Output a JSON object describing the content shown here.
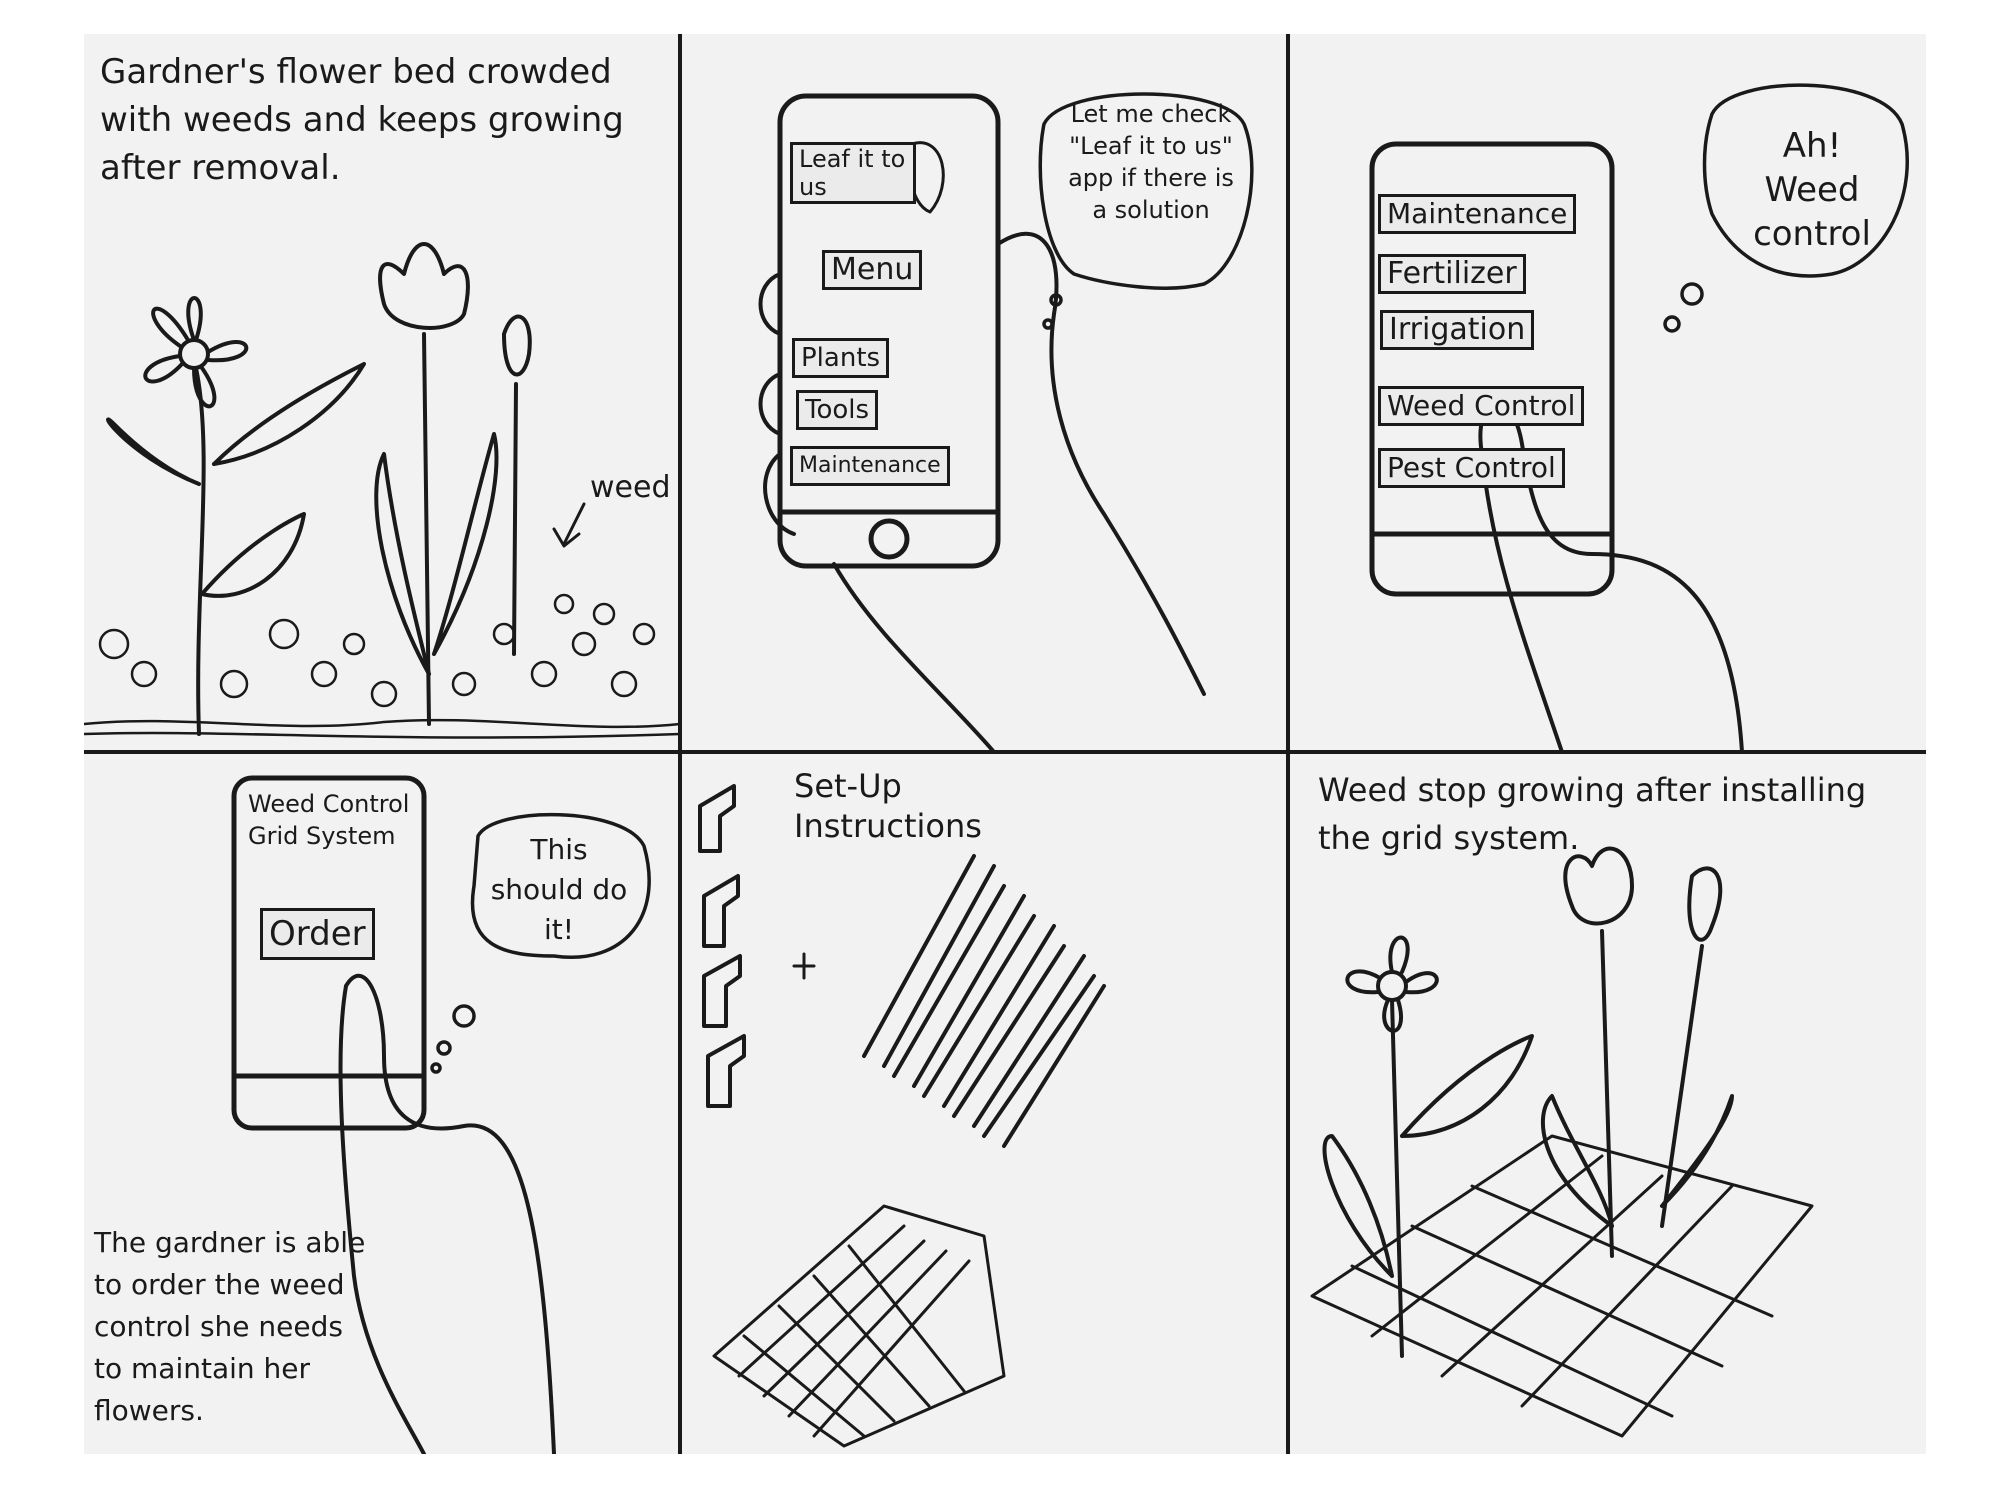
{
  "panels": {
    "p1": {
      "caption": "Gardner's flower bed crowded with weeds and keeps growing after removal.",
      "label": "weed"
    },
    "p2": {
      "app_title": "Leaf it to us",
      "menu": "Menu",
      "items": [
        "Plants",
        "Tools",
        "Maintenance"
      ],
      "bubble": "Let me check \"Leaf it to us\" app if there is a solution"
    },
    "p3": {
      "items": [
        "Maintenance",
        "Fertilizer",
        "Irrigation",
        "Weed Control",
        "Pest Control"
      ],
      "bubble": "Ah! Weed control"
    },
    "p4": {
      "screen_title": "Weed Control Grid System",
      "order": "Order",
      "bubble": "This should do it!",
      "caption": "The gardner is able to order the weed control she needs to maintain her flowers."
    },
    "p5": {
      "title": "Set-Up Instructions",
      "plus": "+"
    },
    "p6": {
      "caption": "Weed stop growing after installing the grid system."
    }
  }
}
